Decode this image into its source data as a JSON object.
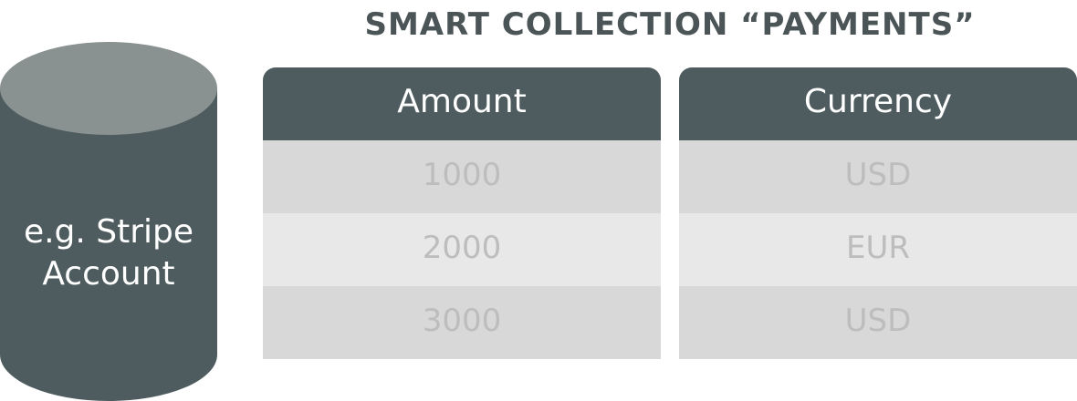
{
  "title": "SMART COLLECTION “PAYMENTS”",
  "database": {
    "label_line1": "e.g. Stripe",
    "label_line2": "Account"
  },
  "table": {
    "columns": [
      {
        "header": "Amount",
        "cells": [
          "1000",
          "2000",
          "3000"
        ]
      },
      {
        "header": "Currency",
        "cells": [
          "USD",
          "EUR",
          "USD"
        ]
      }
    ]
  },
  "colors": {
    "header_bg": "#4e5c5f",
    "cylinder_body": "#4e5c5f",
    "cylinder_top": "#8a9191",
    "row_odd": "#d8d8d8",
    "row_even": "#e8e8e8",
    "cell_text": "#bdbdbd",
    "title_text": "#4b5457"
  }
}
